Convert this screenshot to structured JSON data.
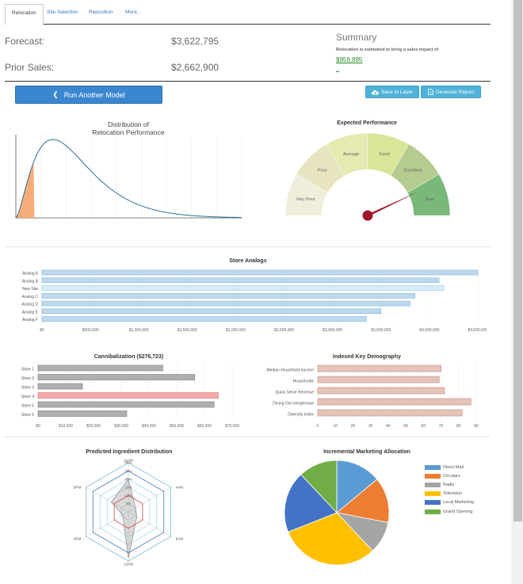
{
  "tabs": [
    "Relocation",
    "Site Selection",
    "Reposition",
    "More..."
  ],
  "stats": {
    "forecast_label": "Forecast:",
    "forecast_value": "$3,622,795",
    "prior_label": "Prior Sales:",
    "prior_value": "$2,662,900"
  },
  "summary": {
    "title": "Summary",
    "text": "Relocation is estimated to bring a sales impact of",
    "value": "$959,895"
  },
  "buttons": {
    "run_model": "Run Another Model",
    "save_layer": "Save to Layer",
    "generate_report": "Generate Report"
  },
  "colors": {
    "primary": "#3a87d0",
    "info": "#4fb2d8",
    "impact": "#2a8a2a"
  },
  "icons": [
    "chevron-left-icon",
    "cloud-upload-icon",
    "document-icon"
  ],
  "chart_data": [
    {
      "type": "area",
      "title": "Distribution of\nRelocation Performance",
      "series": [
        {
          "name": "distribution",
          "shape": "right-skewed curve with shaded left tail"
        }
      ]
    },
    {
      "type": "gauge",
      "title": "Expected Performance",
      "categories": [
        "Very Poor",
        "Poor",
        "Average",
        "Good",
        "Excellent",
        "Best"
      ],
      "colors": [
        "#f0eddb",
        "#e7e4c0",
        "#e4eab0",
        "#d8e69a",
        "#b5cc8e",
        "#78b97a"
      ],
      "value": 0.86
    },
    {
      "type": "bar",
      "title": "Store Analogs",
      "orientation": "horizontal",
      "categories": [
        "Analog A",
        "Analog B",
        "New Site",
        "Analog C",
        "Analog D",
        "Analog E",
        "Analog F"
      ],
      "values": [
        4500000,
        4100000,
        4150000,
        3850000,
        3800000,
        3500000,
        3350000
      ],
      "xlim": [
        0,
        4500000
      ],
      "xticks": [
        "$0",
        "$500,000",
        "$1,000,000",
        "$1,500,000",
        "$2,000,000",
        "$2,500,000",
        "$3,000,000",
        "$3,500,000",
        "$4,000,000",
        "$4,500,000"
      ]
    },
    {
      "type": "bar",
      "title": "Cannibalization ($276,723)",
      "orientation": "horizontal",
      "categories": [
        "Store 1",
        "Store 2",
        "Store 3",
        "Store 4",
        "Store 5",
        "Store 6"
      ],
      "values": [
        45000,
        56500,
        16000,
        65000,
        63500,
        32000
      ],
      "xlim": [
        0,
        70000
      ],
      "xticks": [
        "$0",
        "$10,000",
        "$20,000",
        "$30,000",
        "$40,000",
        "$50,000",
        "$60,000",
        "$70,000"
      ]
    },
    {
      "type": "bar",
      "title": "Indexed Key Demography",
      "orientation": "horizontal",
      "categories": [
        "Median Household Income",
        "Households",
        "Quick Serve Revenue",
        "Dining Out Inexpensive",
        "Diversity Index"
      ],
      "values": [
        70,
        69,
        72,
        87,
        82
      ],
      "xlim": [
        0,
        90
      ],
      "xticks": [
        "0",
        "10",
        "20",
        "30",
        "40",
        "50",
        "60",
        "70",
        "80",
        "90"
      ]
    },
    {
      "type": "radar",
      "title": "Predicted Ingredient Distribution",
      "categories": [
        "12AM",
        "4AM",
        "8AM",
        "12PM",
        "4PM",
        "8PM"
      ],
      "rings": [
        "30%",
        "25%",
        "20%",
        "15%",
        "10%",
        "5%"
      ],
      "series": [
        {
          "values": [
            0.2,
            0.05,
            0.06,
            0.28,
            0.04,
            0.12
          ]
        },
        {
          "values": [
            0.1,
            0.1,
            0.1,
            0.1,
            0.1,
            0.1
          ]
        },
        {
          "values": [
            0.25,
            0.25,
            0.25,
            0.25,
            0.25,
            0.25
          ]
        }
      ]
    },
    {
      "type": "pie",
      "title": "Incremental Marketing Allocation",
      "categories": [
        "Direct Mail",
        "Circulars",
        "Radio",
        "Television",
        "Local Marketing",
        "Grand Opening"
      ],
      "values": [
        14,
        14,
        10,
        31,
        19,
        12
      ],
      "colors": [
        "#5b9bd5",
        "#ed7d31",
        "#a5a5a5",
        "#ffc000",
        "#4472c4",
        "#70ad47"
      ]
    }
  ]
}
